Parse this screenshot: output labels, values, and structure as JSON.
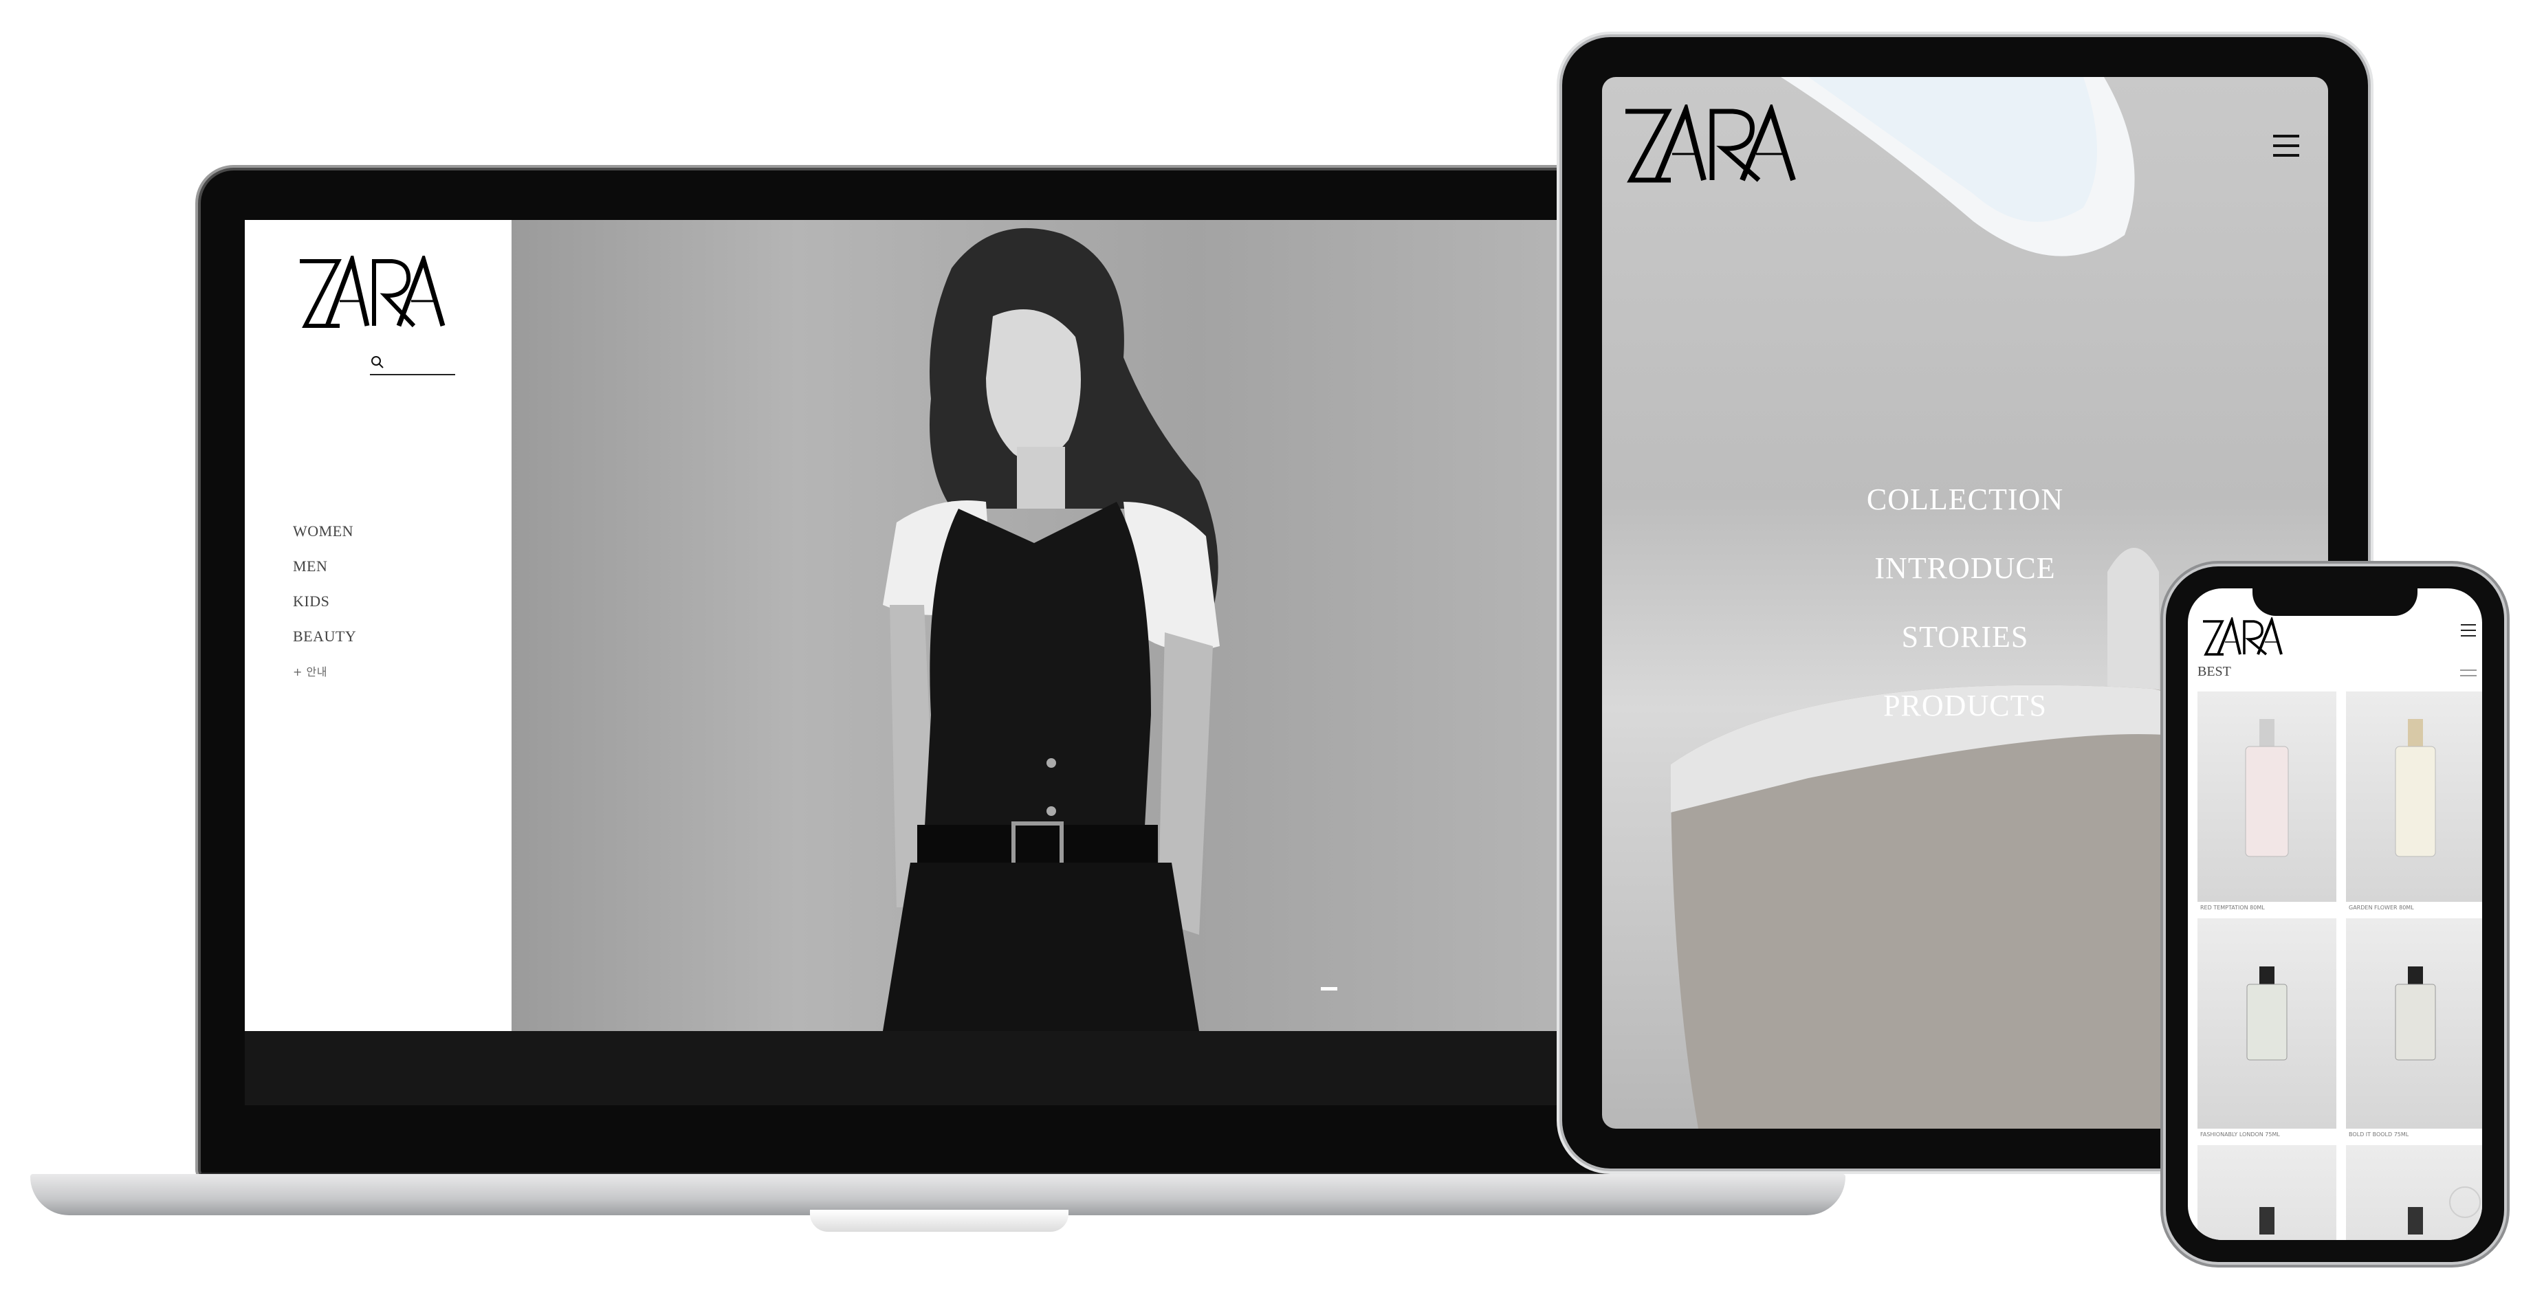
{
  "brand": {
    "name": "ZARA",
    "accent": "#000000",
    "background": "#ffffff"
  },
  "laptop": {
    "sidebar": {
      "nav": [
        {
          "label": "WOMEN"
        },
        {
          "label": "MEN"
        },
        {
          "label": "KIDS"
        },
        {
          "label": "BEAUTY"
        },
        {
          "label": "+ 안내"
        }
      ],
      "search_icon": "search-icon"
    },
    "header_icons": [
      "user-icon",
      "shopping-bag-icon"
    ],
    "slider": {
      "active_index": 1,
      "total": 1
    }
  },
  "tablet": {
    "menu_icon": "hamburger-menu-icon",
    "nav": [
      {
        "label": "COLLECTION"
      },
      {
        "label": "INTRODUCE"
      },
      {
        "label": "STORIES"
      },
      {
        "label": "PRODUCTS"
      }
    ]
  },
  "phone": {
    "menu_icon": "hamburger-menu-icon",
    "section_title": "BEST",
    "products": [
      {
        "name": "RED TEMPTATION 80ML"
      },
      {
        "name": "GARDEN FLOWER 80ML"
      },
      {
        "name": "FASHIONABLY LONDON 75ML"
      },
      {
        "name": "BOLD IT BOOLD 75ML"
      },
      {
        "name": ""
      },
      {
        "name": ""
      }
    ]
  }
}
